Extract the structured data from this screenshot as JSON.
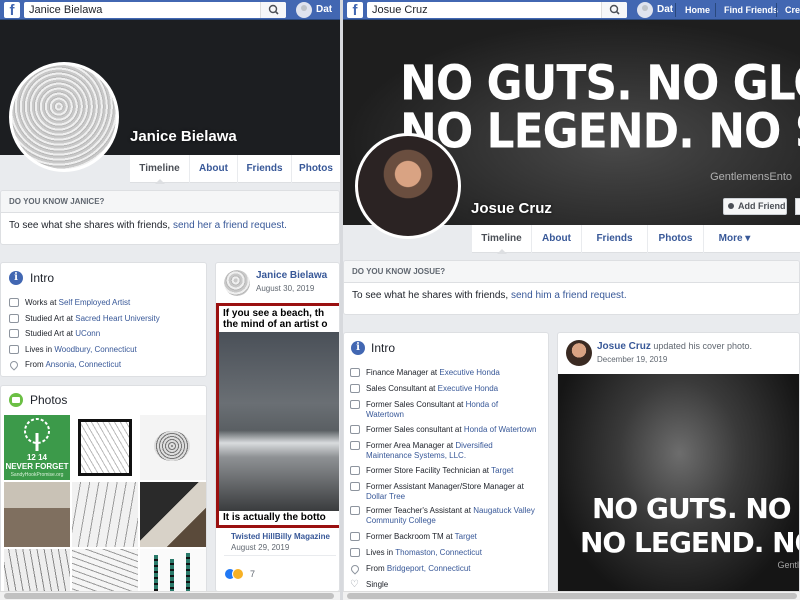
{
  "left": {
    "search_value": "Janice Bielawa",
    "user": "Dat",
    "profile_name": "Janice Bielawa",
    "tabs": [
      "Timeline",
      "About",
      "Friends",
      "Photos"
    ],
    "know": {
      "header": "DO YOU KNOW JANICE?",
      "text": "To see what she shares with friends, ",
      "link": "send her a friend request."
    },
    "intro": {
      "title": "Intro",
      "items": [
        {
          "pre": "Works at ",
          "link": "Self Employed Artist",
          "icon": "briefcase-icon"
        },
        {
          "pre": "Studied Art at ",
          "link": "Sacred Heart University",
          "icon": "graduation-cap-icon"
        },
        {
          "pre": "Studied Art at ",
          "link": "UConn",
          "icon": "graduation-cap-icon"
        },
        {
          "pre": "Lives in ",
          "link": "Woodbury, Connecticut",
          "icon": "home-icon"
        },
        {
          "pre": "From ",
          "link": "Ansonia, Connecticut",
          "icon": "location-pin-icon"
        }
      ]
    },
    "photos": {
      "title": "Photos",
      "tree_date": "12 14",
      "tree_caption": "NEVER FORGET",
      "tree_sub": "SandyHookPromise.org"
    },
    "post": {
      "author": "Janice Bielawa",
      "date": "August 30, 2019",
      "meme_top": "If you see a beach, th the mind of an artist o",
      "meme_bottom": "It is actually the botto",
      "shared_from": "Twisted HillBilly Magazine",
      "shared_date": "August 29, 2019",
      "reaction_count": "7"
    }
  },
  "right": {
    "search_value": "Josue Cruz",
    "user": "Dat",
    "nav": [
      "Home",
      "Find Friends",
      "Cre"
    ],
    "cover_line1": "NO GUTS. NO GLORY",
    "cover_line2": "NO LEGEND. NO STOR",
    "cover_watermark": "GentlemensEnto",
    "profile_name": "Josue Cruz",
    "add_friend": "Add Friend",
    "tabs": [
      "Timeline",
      "About",
      "Friends",
      "Photos",
      "More ▾"
    ],
    "know": {
      "header": "DO YOU KNOW JOSUE?",
      "text": "To see what he shares with friends, ",
      "link": "send him a friend request."
    },
    "intro": {
      "title": "Intro",
      "items": [
        {
          "pre": "Finance Manager at ",
          "link": "Executive Honda",
          "icon": "briefcase-icon"
        },
        {
          "pre": "Sales Consultant at ",
          "link": "Executive Honda",
          "icon": "briefcase-icon"
        },
        {
          "pre": "Former Sales Consultant at ",
          "link": "Honda of Watertown",
          "icon": "briefcase-icon"
        },
        {
          "pre": "Former Sales consultant at ",
          "link": "Honda of Watertown",
          "icon": "briefcase-icon"
        },
        {
          "pre": "Former Area Manager at ",
          "link": "Diversified Maintenance Systems, LLC.",
          "icon": "briefcase-icon"
        },
        {
          "pre": "Former Store Facility Technician at ",
          "link": "Target",
          "icon": "briefcase-icon"
        },
        {
          "pre": "Former Assistant Manager/Store Manager at ",
          "link": "Dollar Tree",
          "icon": "briefcase-icon"
        },
        {
          "pre": "Former Teacher's Assistant at ",
          "link": "Naugatuck Valley Community College",
          "icon": "briefcase-icon"
        },
        {
          "pre": "Former Backroom TM at ",
          "link": "Target",
          "icon": "briefcase-icon"
        },
        {
          "pre": "Lives in ",
          "link": "Thomaston, Connecticut",
          "icon": "home-icon"
        },
        {
          "pre": "From ",
          "link": "Bridgeport, Connecticut",
          "icon": "location-pin-icon"
        },
        {
          "pre": "Single",
          "link": "",
          "icon": "heart-icon"
        }
      ]
    },
    "post": {
      "author": "Josue Cruz",
      "action": " updated his cover photo.",
      "date": "December 19, 2019",
      "line1": "NO GUTS. NO GLO",
      "line2": "NO LEGEND. NO ST",
      "watermark": "Gentl"
    }
  }
}
